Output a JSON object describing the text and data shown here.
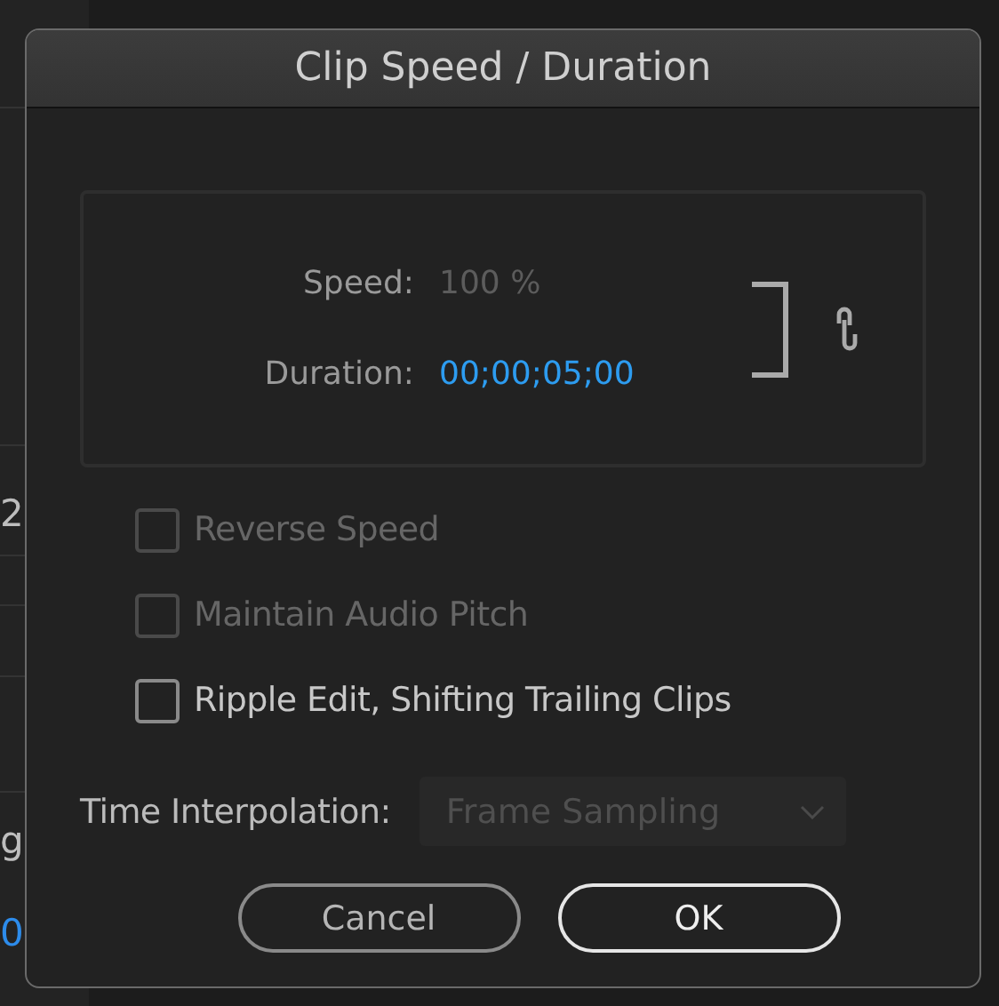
{
  "background": {
    "texts": [
      {
        "text": "2",
        "kind": "plain"
      },
      {
        "text": "g",
        "kind": "plain"
      },
      {
        "text": "0",
        "kind": "timecode"
      }
    ]
  },
  "window": {
    "title": "Clip Speed / Duration"
  },
  "fields": [
    {
      "kind": "speed",
      "label": "Speed:",
      "value": "100 %",
      "disabled": true
    },
    {
      "kind": "duration",
      "label": "Duration:",
      "value": "00;00;05;00",
      "disabled": false
    }
  ],
  "link": {
    "linked": true
  },
  "checkboxes": [
    {
      "label": "Reverse Speed",
      "checked": false,
      "disabled": true
    },
    {
      "label": "Maintain Audio Pitch",
      "checked": false,
      "disabled": true
    },
    {
      "label": "Ripple Edit, Shifting Trailing Clips",
      "checked": false,
      "disabled": false
    }
  ],
  "time_interpolation": {
    "label": "Time Interpolation:",
    "value": "Frame Sampling",
    "disabled": true
  },
  "buttons": [
    {
      "label": "Cancel",
      "kind": "default"
    },
    {
      "label": "OK",
      "kind": "primary"
    }
  ]
}
